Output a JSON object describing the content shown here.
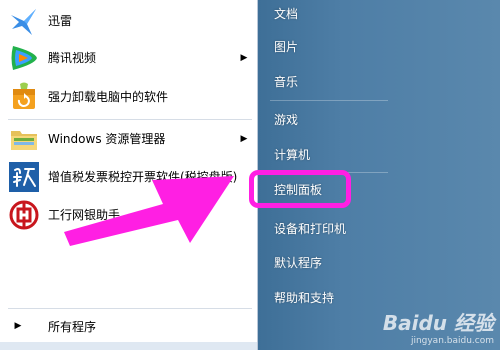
{
  "left_pane": {
    "items": [
      {
        "label": "迅雷",
        "icon": "thunder-bird-icon",
        "has_submenu": false
      },
      {
        "label": "腾讯视频",
        "icon": "tencent-video-icon",
        "has_submenu": true
      },
      {
        "label": "强力卸载电脑中的软件",
        "icon": "uninstall-box-icon",
        "has_submenu": false
      },
      {
        "label": "Windows 资源管理器",
        "icon": "folder-explorer-icon",
        "has_submenu": true
      },
      {
        "label": "增值税发票税控开票软件(税控盘版)",
        "icon": "tax-software-icon",
        "has_submenu": false
      },
      {
        "label": "工行网银助手",
        "icon": "icbc-icon",
        "has_submenu": false
      }
    ],
    "all_programs": "所有程序"
  },
  "right_pane": {
    "items": [
      {
        "label": "文档"
      },
      {
        "label": "图片"
      },
      {
        "label": "音乐"
      },
      {
        "label": "游戏"
      },
      {
        "label": "计算机"
      },
      {
        "label": "控制面板"
      },
      {
        "label": "设备和打印机"
      },
      {
        "label": "默认程序"
      },
      {
        "label": "帮助和支持"
      }
    ]
  },
  "annotation": {
    "highlight_color": "#ff1fe3",
    "highlighted_item": "控制面板"
  },
  "colors": {
    "right_pane_bg": "#4e7ea6",
    "highlight": "#ff1fe3"
  },
  "watermark": {
    "main": "Baidu 经验",
    "sub": "jingyan.baidu.com"
  }
}
